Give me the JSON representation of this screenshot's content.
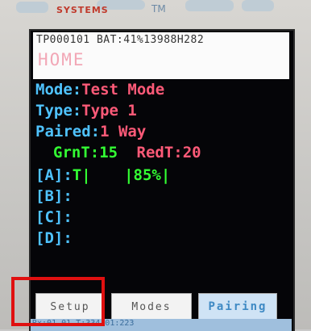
{
  "brand": {
    "name": "SYSTEMS",
    "tm": "TM"
  },
  "header": {
    "status_line": "TP000101 BAT:41%13988H282",
    "title": "HOME"
  },
  "fields": {
    "mode_label": "Mode:",
    "mode_value": "Test Mode",
    "type_label": "Type:",
    "type_value": "Type 1",
    "paired_label": "Paired:",
    "paired_value": "1 Way",
    "grnt": "GrnT:15",
    "redt": "RedT:20",
    "a_label": "[A]:",
    "a_value": "T|",
    "a_percent": "|85%|",
    "b_label": "[B]:",
    "c_label": "[C]:",
    "d_label": "[D]:"
  },
  "buttons": {
    "setup": "Setup",
    "modes": "Modes",
    "pairing": "Pairing"
  },
  "status_bar": "Rx:01.01 T:334 01:223",
  "colors": {
    "label": "#4fc3ff",
    "value": "#ff5a78",
    "green": "#33ff33",
    "highlight": "#e01010"
  }
}
